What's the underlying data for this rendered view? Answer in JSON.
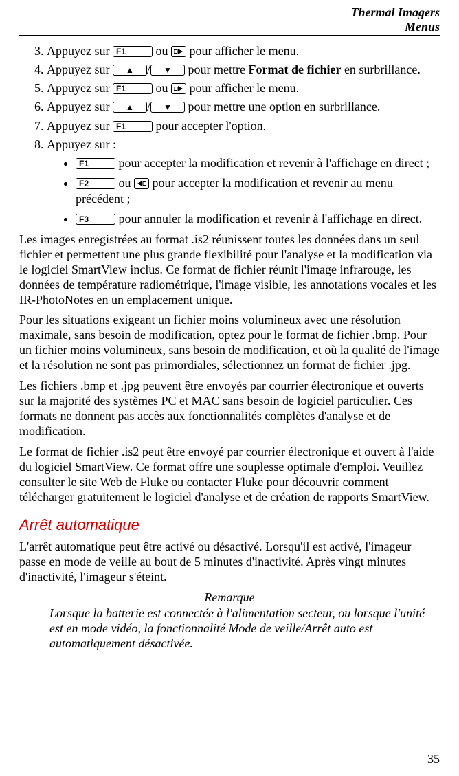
{
  "header": {
    "title": "Thermal Imagers",
    "subtitle": "Menus"
  },
  "keys": {
    "f1": "F1",
    "f2": "F2",
    "f3": "F3",
    "up": "▲",
    "down": "▼"
  },
  "steps": {
    "s3a": "Appuyez sur ",
    "s3b": " ou ",
    "s3c": " pour afficher le menu.",
    "s4a": "Appuyez sur ",
    "s4b": "/",
    "s4c": " pour mettre ",
    "s4d": "Format de fichier",
    "s4e": " en surbrillance.",
    "s5a": "Appuyez sur ",
    "s5b": " ou ",
    "s5c": " pour afficher le menu.",
    "s6a": "Appuyez sur ",
    "s6b": "/",
    "s6c": " pour mettre une option en surbrillance.",
    "s7a": "Appuyez sur ",
    "s7b": " pour accepter l'option.",
    "s8": "Appuyez sur :",
    "b1a": " pour accepter la modification et revenir à l'affichage en direct ;",
    "b2a": " ou ",
    "b2b": " pour accepter la modification et revenir au menu précédent ;",
    "b3a": " pour annuler la modification et revenir à l'affichage en direct."
  },
  "paras": {
    "p1": "Les images enregistrées au format .is2 réunissent toutes les données dans un seul fichier et permettent une plus grande flexibilité pour l'analyse et la modification via le logiciel SmartView inclus. Ce format de fichier réunit l'image infrarouge, les données de température radiométrique, l'image visible, les annotations vocales et les IR‑PhotoNotes en un emplacement unique.",
    "p2": "Pour les situations exigeant un fichier moins volumineux avec une résolution maximale, sans besoin de modification, optez pour le format de fichier .bmp. Pour un fichier moins volumineux, sans besoin de modification, et où la qualité de l'image et la résolution ne sont pas primordiales, sélectionnez un format de fichier .jpg.",
    "p3": "Les fichiers .bmp et .jpg peuvent être envoyés par courrier électronique et ouverts sur la majorité des systèmes PC et MAC sans besoin de logiciel particulier. Ces formats ne donnent pas accès aux fonctionnalités complètes d'analyse et de modification.",
    "p4": "Le format de fichier .is2 peut être envoyé par courrier électronique et ouvert à l'aide du logiciel SmartView. Ce format offre une souplesse optimale d'emploi. Veuillez consulter le site Web de Fluke ou contacter Fluke pour découvrir comment télécharger gratuitement le logiciel d'analyse et de création de rapports SmartView."
  },
  "section": {
    "heading": "Arrêt automatique",
    "body": "L'arrêt automatique peut être activé ou désactivé. Lorsqu'il est activé, l'imageur passe en mode de veille au bout de 5 minutes d'inactivité. Après vingt minutes d'inactivité, l'imageur s'éteint.",
    "noteLabel": "Remarque",
    "noteBody": "Lorsque la batterie est connectée à l'alimentation secteur, ou lorsque l'unité est en mode vidéo, la fonctionnalité Mode de veille/Arrêt auto est automatiquement désactivée."
  },
  "pageNumber": "35"
}
